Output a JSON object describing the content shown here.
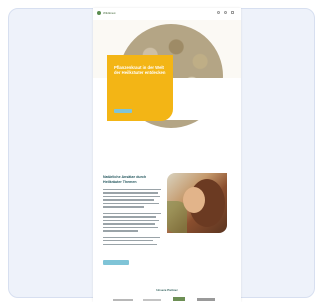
{
  "topbar": {
    "brand": "Wildkraut",
    "brand_color": "#5a8c4f",
    "icons": [
      "search-icon",
      "user-icon",
      "menu-icon"
    ]
  },
  "hero": {
    "title": "Pflanzenkraut in der Welt der Heilkräuter entdecken",
    "subtitle": "",
    "button_label": "",
    "box_color": "#f3b515",
    "button_color": "#7fc4d7"
  },
  "section": {
    "title": "Natürliche Ansätze durch Heilkräuter Themen",
    "button_label": "",
    "title_color": "#24575e"
  },
  "partners": {
    "title": "Unsere Partner",
    "logo_count": 4
  }
}
